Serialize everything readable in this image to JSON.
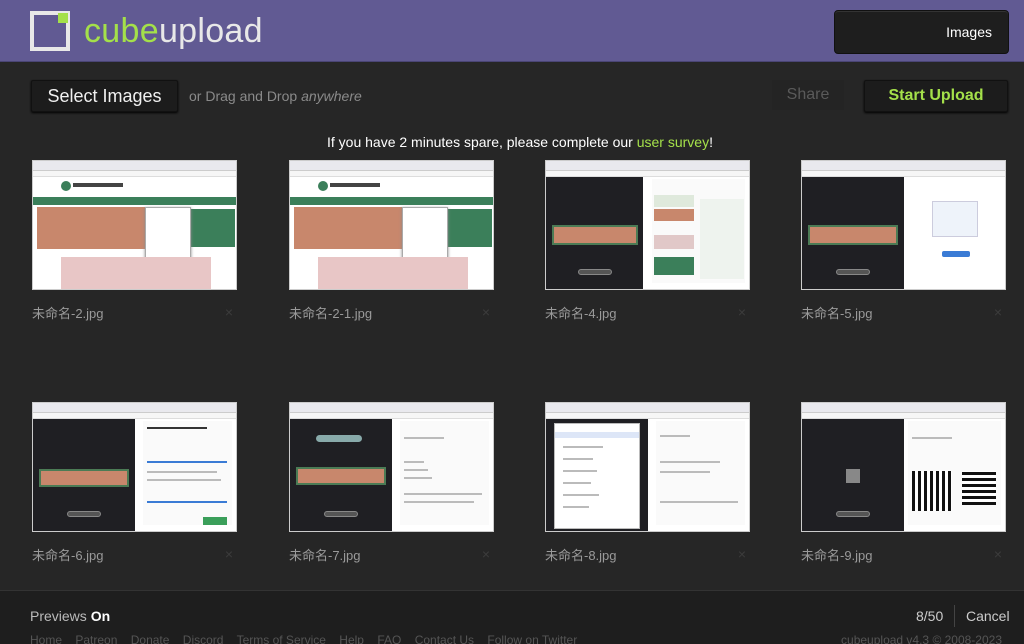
{
  "header": {
    "logo_cube": "cube",
    "logo_upload": "upload",
    "nav_images": "Images"
  },
  "toolbar": {
    "select_images": "Select Images",
    "drag_prefix": "or Drag and Drop",
    "drag_em": "anywhere",
    "share": "Share",
    "start_upload": "Start Upload"
  },
  "survey": {
    "text": "If you have 2 minutes spare, please complete our",
    "link": "user survey",
    "suffix": "!"
  },
  "images": [
    {
      "name": "未命名-2.jpg",
      "kind": "site"
    },
    {
      "name": "未命名-2-1.jpg",
      "kind": "site"
    },
    {
      "name": "未命名-4.jpg",
      "kind": "dark-cards"
    },
    {
      "name": "未命名-5.jpg",
      "kind": "dark-chart"
    },
    {
      "name": "未命名-6.jpg",
      "kind": "dark-text"
    },
    {
      "name": "未命名-7.jpg",
      "kind": "dark-text"
    },
    {
      "name": "未命名-8.jpg",
      "kind": "dark-list"
    },
    {
      "name": "未命名-9.jpg",
      "kind": "dark-qr"
    }
  ],
  "remove_icon": "×",
  "footer": {
    "previews_label": "Previews",
    "previews_state": "On",
    "count": "8/50",
    "cancel": "Cancel",
    "links": [
      "Home",
      "Patreon",
      "Donate",
      "Discord",
      "Terms of Service",
      "Help",
      "FAQ",
      "Contact Us",
      "Follow on Twitter"
    ],
    "copyright": "cubeupload v4.3 © 2008-2023"
  },
  "colors": {
    "brand_green": "#a4e04a",
    "header_purple": "#615a93",
    "background": "#262626"
  }
}
